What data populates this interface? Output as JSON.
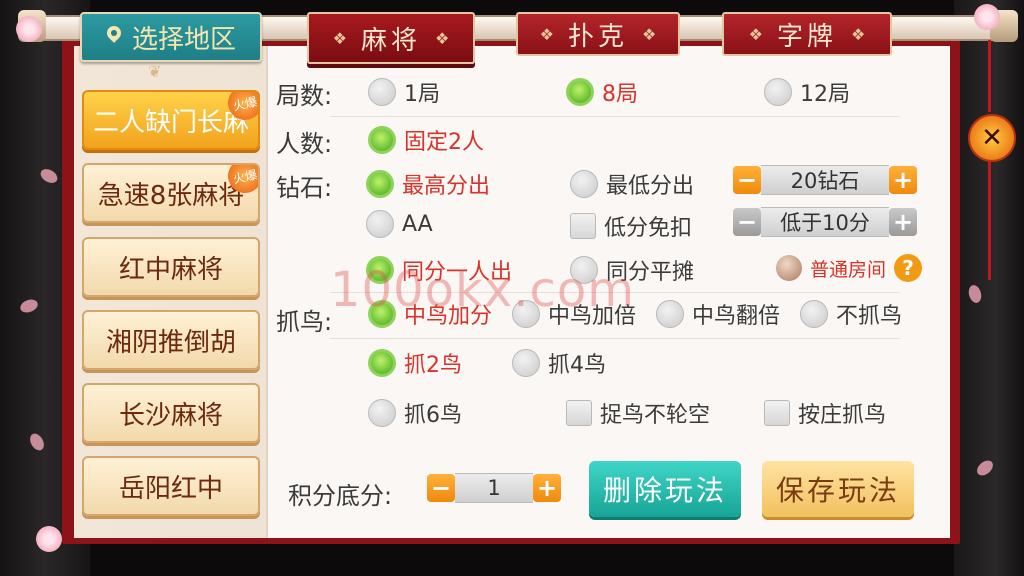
{
  "region": {
    "label": "选择地区"
  },
  "categories": [
    {
      "label": "麻将",
      "active": true
    },
    {
      "label": "扑克",
      "active": false
    },
    {
      "label": "字牌",
      "active": false
    }
  ],
  "games": [
    {
      "label": "二人缺门长麻",
      "hot": "火爆",
      "active": true
    },
    {
      "label": "急速8张麻将",
      "hot": "火爆",
      "active": false
    },
    {
      "label": "红中麻将",
      "active": false
    },
    {
      "label": "湘阴推倒胡",
      "active": false
    },
    {
      "label": "长沙麻将",
      "active": false
    },
    {
      "label": "岳阳红中",
      "active": false
    }
  ],
  "settings": {
    "rounds": {
      "label": "局数:",
      "options": [
        {
          "text": "1局",
          "selected": false
        },
        {
          "text": "8局",
          "selected": true
        },
        {
          "text": "12局",
          "selected": false
        }
      ]
    },
    "players": {
      "label": "人数:",
      "options": [
        {
          "text": "固定2人",
          "selected": true
        }
      ]
    },
    "diamond": {
      "label": "钻石:",
      "row1": [
        {
          "text": "最高分出",
          "selected": true
        },
        {
          "text": "最低分出",
          "selected": false
        }
      ],
      "stepper1": {
        "value": "20钻石"
      },
      "row2_radio": {
        "text": "AA",
        "selected": false
      },
      "row2_check": {
        "text": "低分免扣",
        "checked": false
      },
      "stepper2": {
        "value": "低于10分"
      },
      "row3": [
        {
          "text": "同分一人出",
          "selected": true
        },
        {
          "text": "同分平摊",
          "selected": false
        }
      ],
      "room_type": "普通房间"
    },
    "bird": {
      "label": "抓鸟:",
      "mode": [
        {
          "text": "中鸟加分",
          "selected": true
        },
        {
          "text": "中鸟加倍",
          "selected": false
        },
        {
          "text": "中鸟翻倍",
          "selected": false
        },
        {
          "text": "不抓鸟",
          "selected": false
        }
      ],
      "count": [
        {
          "text": "抓2鸟",
          "selected": true
        },
        {
          "text": "抓4鸟",
          "selected": false
        },
        {
          "text": "抓6鸟",
          "selected": false
        }
      ],
      "extras": [
        {
          "text": "捉鸟不轮空",
          "checked": false
        },
        {
          "text": "按庄抓鸟",
          "checked": false
        }
      ]
    },
    "base_score": {
      "label": "积分底分:",
      "value": "1"
    }
  },
  "buttons": {
    "delete": "删除玩法",
    "save": "保存玩法",
    "close": "✕",
    "minus": "−",
    "plus": "+",
    "help": "?"
  },
  "watermark": "100okx.com"
}
